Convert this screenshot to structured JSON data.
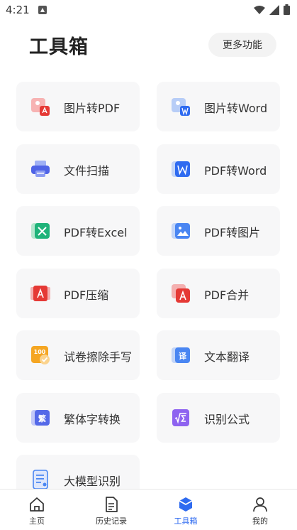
{
  "status": {
    "time": "4:21"
  },
  "header": {
    "title": "工具箱",
    "more_label": "更多功能"
  },
  "tools": [
    {
      "label": "图片转PDF"
    },
    {
      "label": "图片转Word"
    },
    {
      "label": "文件扫描"
    },
    {
      "label": "PDF转Word"
    },
    {
      "label": "PDF转Excel"
    },
    {
      "label": "PDF转图片"
    },
    {
      "label": "PDF压缩"
    },
    {
      "label": "PDF合并"
    },
    {
      "label": "试卷擦除手写"
    },
    {
      "label": "文本翻译"
    },
    {
      "label": "繁体字转换"
    },
    {
      "label": "识别公式"
    },
    {
      "label": "大模型识别"
    }
  ],
  "nav": [
    {
      "label": "主页"
    },
    {
      "label": "历史记录"
    },
    {
      "label": "工具箱"
    },
    {
      "label": "我的"
    }
  ],
  "colors": {
    "accent": "#2f6bf0",
    "card_bg": "#f7f7f8"
  }
}
